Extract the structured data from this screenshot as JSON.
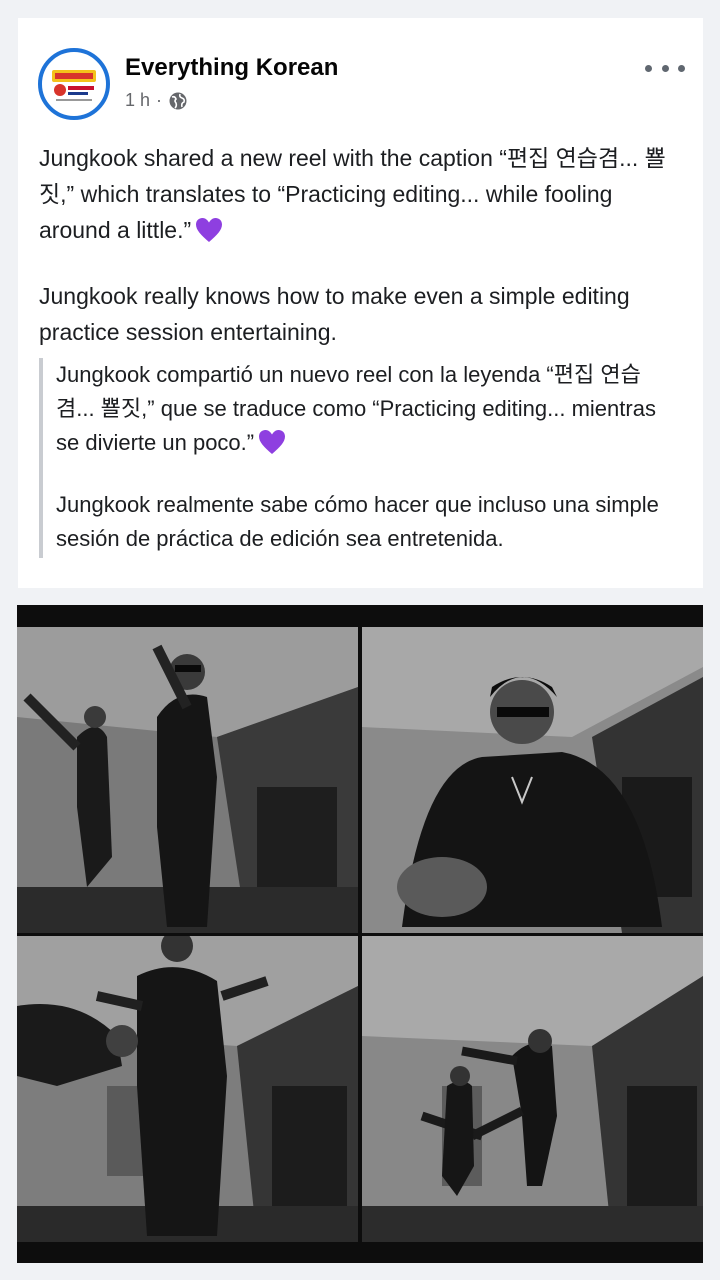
{
  "post": {
    "page_name": "Everything Korean",
    "time": "1 h",
    "separator": "·",
    "text": [
      "Jungkook shared a new reel with the caption “편집 연습겸... 뾸짓,” which translates to “Practicing editing... while fooling around a little.”",
      "Jungkook really knows how to make even a simple editing practice session entertaining."
    ],
    "translation": [
      "Jungkook compartió un nuevo reel con la leyenda “편집 연습겸... 뾸짓,” que se traduce como “Practicing editing... mientras se divierte un poco.”",
      "Jungkook realmente sabe cómo hacer que incluso una simple sesión de práctica de edición sea entretenida."
    ]
  },
  "icons": {
    "avatar": "everything-korean-logo",
    "privacy": "globe-icon",
    "menu": "more-horizontal-icon",
    "emoji": "purple-heart"
  },
  "colors": {
    "avatar_ring": "#1e73d8",
    "heart": "#8e3fe0"
  },
  "media": {
    "type": "photo-collage",
    "panels": 4
  }
}
